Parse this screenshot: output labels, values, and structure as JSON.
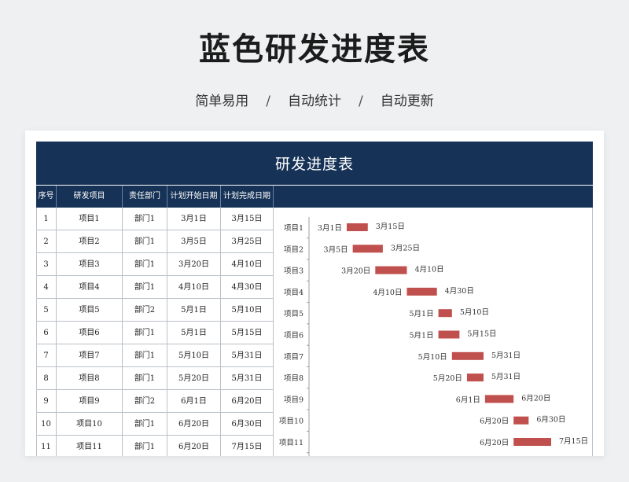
{
  "page": {
    "title": "蓝色研发进度表",
    "tags": [
      "简单易用",
      "自动统计",
      "自动更新"
    ],
    "separator": "/"
  },
  "sheet": {
    "banner": "研发进度表",
    "headers": [
      "序号",
      "研发项目",
      "责任部门",
      "计划开始日期",
      "计划完成日期"
    ],
    "rows": [
      {
        "no": "1",
        "project": "项目1",
        "dept": "部门1",
        "start": "3月1日",
        "end": "3月15日"
      },
      {
        "no": "2",
        "project": "项目2",
        "dept": "部门1",
        "start": "3月5日",
        "end": "3月25日"
      },
      {
        "no": "3",
        "project": "项目3",
        "dept": "部门1",
        "start": "3月20日",
        "end": "4月10日"
      },
      {
        "no": "4",
        "project": "项目4",
        "dept": "部门1",
        "start": "4月10日",
        "end": "4月30日"
      },
      {
        "no": "5",
        "project": "项目5",
        "dept": "部门2",
        "start": "5月1日",
        "end": "5月10日"
      },
      {
        "no": "6",
        "project": "项目6",
        "dept": "部门1",
        "start": "5月1日",
        "end": "5月15日"
      },
      {
        "no": "7",
        "project": "项目7",
        "dept": "部门1",
        "start": "5月10日",
        "end": "5月31日"
      },
      {
        "no": "8",
        "project": "项目8",
        "dept": "部门1",
        "start": "5月20日",
        "end": "5月31日"
      },
      {
        "no": "9",
        "project": "项目9",
        "dept": "部门2",
        "start": "6月1日",
        "end": "6月20日"
      },
      {
        "no": "10",
        "project": "项目10",
        "dept": "部门1",
        "start": "6月20日",
        "end": "6月30日"
      },
      {
        "no": "11",
        "project": "项目11",
        "dept": "部门1",
        "start": "6月20日",
        "end": "7月15日"
      }
    ]
  },
  "chart_data": {
    "type": "bar",
    "orientation": "horizontal-gantt",
    "bar_color": "#c0504d",
    "categories": [
      "项目1",
      "项目2",
      "项目3",
      "项目4",
      "项目5",
      "项目6",
      "项目7",
      "项目8",
      "项目9",
      "项目10",
      "项目11"
    ],
    "start": [
      "03-01",
      "03-05",
      "03-20",
      "04-10",
      "05-01",
      "05-01",
      "05-10",
      "05-20",
      "06-01",
      "06-20",
      "06-20"
    ],
    "end": [
      "03-15",
      "03-25",
      "04-10",
      "04-30",
      "05-10",
      "05-15",
      "05-31",
      "05-31",
      "06-20",
      "06-30",
      "07-15"
    ],
    "start_labels": [
      "3月1日",
      "3月5日",
      "3月20日",
      "4月10日",
      "5月1日",
      "5月1日",
      "5月10日",
      "5月20日",
      "6月1日",
      "6月20日",
      "6月20日"
    ],
    "end_labels": [
      "3月15日",
      "3月25日",
      "4月10日",
      "4月30日",
      "5月10日",
      "5月15日",
      "5月31日",
      "5月31日",
      "6月20日",
      "6月30日",
      "7月15日"
    ],
    "xlim": [
      "03-01",
      "07-15"
    ]
  }
}
